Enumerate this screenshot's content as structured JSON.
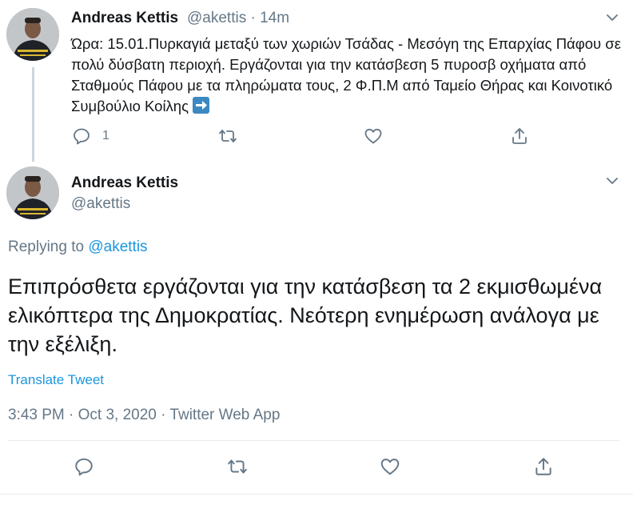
{
  "tweet1": {
    "author_name": "Andreas Kettis",
    "author_handle": "@akettis",
    "separator": "·",
    "time_ago": "14m",
    "text": "Ώρα: 15.01.Πυρκαγιά μεταξύ των χωριών Τσάδας - Μεσόγη της Επαρχίας Πάφου σε πολύ δύσβατη περιοχή. Εργάζονται για την κατάσβεση 5 πυροσβ οχήματα από Σταθμούς Πάφου με τα πληρώματα τους, 2 Φ.Π.Μ από Ταμείο Θήρας και Κοινοτικό Συμβούλιο Κοίλης",
    "emoji": "right-arrow-emoji",
    "reply_count": "1",
    "icons": [
      "reply-icon",
      "retweet-icon",
      "like-icon",
      "share-icon",
      "chevron-down-icon"
    ]
  },
  "tweet2": {
    "author_name": "Andreas Kettis",
    "author_handle": "@akettis",
    "replying_prefix": "Replying to",
    "replying_handle": "@akettis",
    "text": "Επιπρόσθετα εργάζονται για την κατάσβεση τα 2 εκμισθωμένα ελικόπτερα της Δημοκρατίας. Νεότερη ενημέρωση ανάλογα με την εξέλιξη.",
    "translate_label": "Translate Tweet",
    "meta": "3:43 PM · Oct 3, 2020 · Twitter Web App",
    "icons": [
      "reply-icon",
      "retweet-icon",
      "like-icon",
      "share-icon",
      "chevron-down-icon"
    ]
  },
  "colors": {
    "text": "#14171a",
    "secondary": "#657786",
    "link": "#1b95e0",
    "divider": "#e6ecf0",
    "thread_line": "#ccd6dd"
  }
}
